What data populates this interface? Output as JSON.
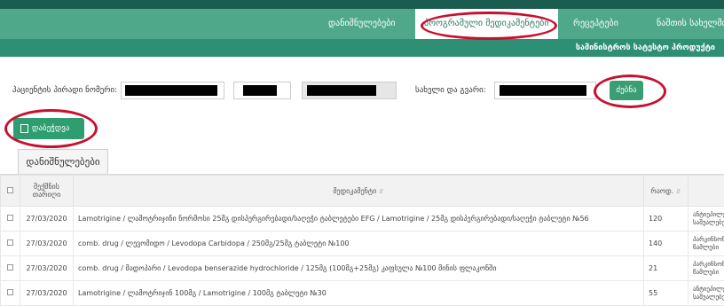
{
  "nav": {
    "items": [
      "დანიშნულებები",
      "პროგრამული მედიკამენტები",
      "რეცეპტები",
      "ნაშთის სახელმძღ"
    ],
    "sub_item": "სამინისტროს სატესტო პროდუქტი"
  },
  "form": {
    "id_label": "პაციენტის პირადი ნომერი:",
    "name_label": "სახელი და გვარი:",
    "search_label": "ძებნა"
  },
  "print_label": "დაბეჭდვა",
  "tab_label": "დანიშნულებები",
  "table": {
    "headers": [
      "შექმნის თარიღი",
      "მედიკამენტი",
      "რაოდ."
    ],
    "rows": [
      {
        "date": "27/03/2020",
        "med": "Lamotrigine / ლამოტრიჯინი ნორმოსი 25მგ დისპერგირებადი/საღეჭი ტაბლეტები EFG / Lamotrigine / 25მგ დისპერგირებადი/საღეჭი ტაბლეტი №56",
        "qty": "120",
        "extra": "ანტიეპილეპ საშუალებე"
      },
      {
        "date": "27/03/2020",
        "med": "comb. drug / ლევომიდო / Levodopa Carbidopa / 250მგ/25მგ ტაბლეტი №100",
        "qty": "140",
        "extra": "პარკინსონს წამლები"
      },
      {
        "date": "27/03/2020",
        "med": "comb. drug / მადოპარი / Levodopa benserazide hydrochloride / 125მგ (100მგ+25მგ) კაფსულა №100 მინის ფლაკონში",
        "qty": "21",
        "extra": "პარკინსონს წამლები"
      },
      {
        "date": "27/03/2020",
        "med": "Lamotrigine / ლამოტრიჯინ 100მგ / Lamotrigine / 100მგ ტაბლეტი №30",
        "qty": "55",
        "extra": "ანტიეპილეპ საშუალებე"
      }
    ]
  }
}
